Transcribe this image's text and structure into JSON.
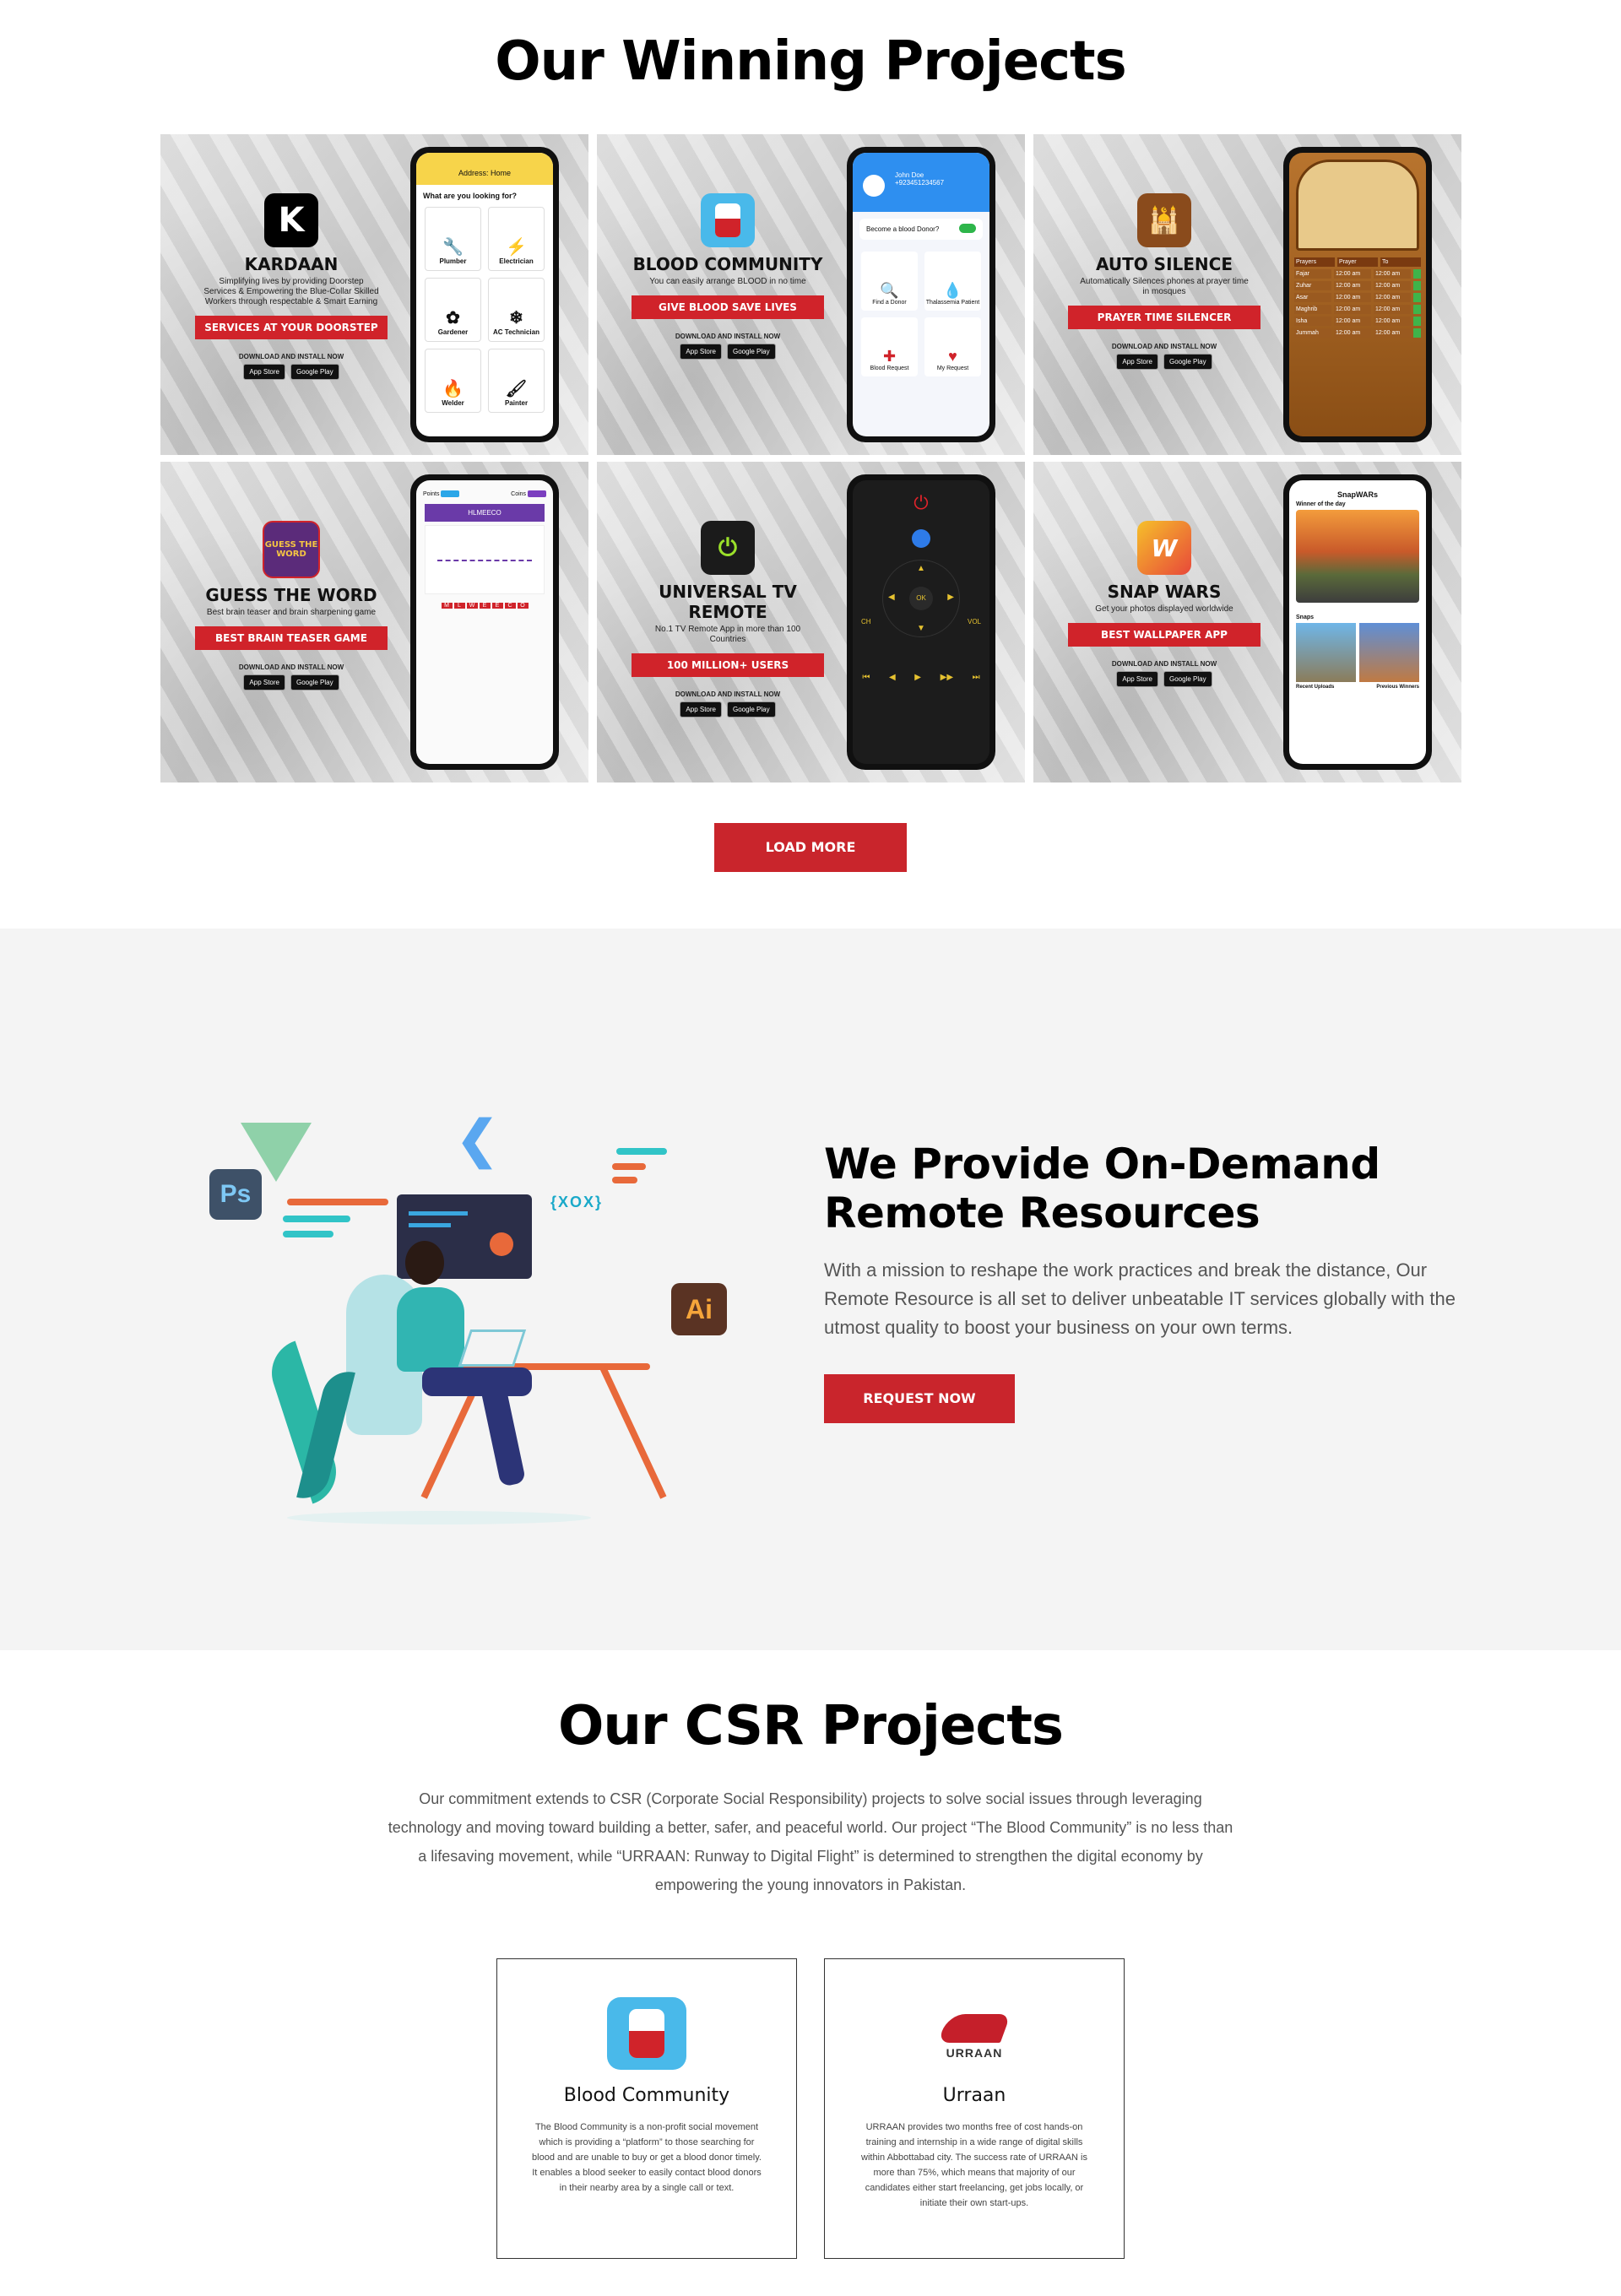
{
  "winning": {
    "title": "Our Winning Projects",
    "load_more": "LOAD MORE",
    "projects": [
      {
        "name": "KARDAAN",
        "sub": "Simplifying lives by providing Doorstep Services & Empowering the Blue-Collar Skilled Workers through respectable & Smart Earning",
        "tag": "SERVICES AT YOUR DOORSTEP",
        "download": "DOWNLOAD AND INSTALL NOW",
        "app_store": "App Store",
        "google_play": "Google Play",
        "screen_header": "Address: Home",
        "screen_question": "What are you looking for?",
        "services": [
          "Plumber",
          "Electrician",
          "Gardener",
          "AC Technician",
          "Welder",
          "Painter"
        ]
      },
      {
        "name": "BLOOD COMMUNITY",
        "sub": "You can easily arrange BLOOD in no time",
        "tag": "GIVE BLOOD SAVE LIVES",
        "download": "DOWNLOAD AND INSTALL NOW",
        "app_store": "App Store",
        "google_play": "Google Play",
        "user_name": "John Doe",
        "user_phone": "+923451234567",
        "donor_toggle": "Become a blood Donor?",
        "options": [
          "Find a Donor",
          "Thalassemia Patient",
          "Blood Request",
          "My Request"
        ]
      },
      {
        "name": "AUTO SILENCE",
        "sub": "Automatically Silences phones at prayer time in mosques",
        "tag": "PRAYER TIME SILENCER",
        "download": "DOWNLOAD AND INSTALL NOW",
        "app_store": "App Store",
        "google_play": "Google Play",
        "table_head": [
          "Prayers",
          "Prayer",
          "To"
        ],
        "prayers": [
          "Fajar",
          "Zuhar",
          "Asar",
          "Maghrib",
          "Isha",
          "Jummah"
        ],
        "time": "12:00 am"
      },
      {
        "name": "GUESS THE WORD",
        "sub": "Best brain teaser and brain sharpening game",
        "tag": "BEST BRAIN TEASER GAME",
        "download": "DOWNLOAD AND INSTALL NOW",
        "app_store": "App Store",
        "google_play": "Google Play",
        "icon_text": "GUESS THE WORD",
        "points_label": "Points",
        "coins_label": "Coins",
        "scrambled": "HLMEECO",
        "letters": [
          "M",
          "L",
          "W",
          "E",
          "E",
          "C",
          "O"
        ]
      },
      {
        "name": "UNIVERSAL TV REMOTE",
        "sub": "No.1 TV Remote App in more than 100 Countries",
        "tag": "100 MILLION+ USERS",
        "download": "DOWNLOAD AND INSTALL NOW",
        "app_store": "App Store",
        "google_play": "Google Play",
        "ok": "OK",
        "ch": "CH",
        "vol": "VOL"
      },
      {
        "name": "SNAP WARS",
        "sub": "Get your photos displayed worldwide",
        "tag": "BEST WALLPAPER APP",
        "download": "DOWNLOAD AND INSTALL NOW",
        "app_store": "App Store",
        "google_play": "Google Play",
        "screen_title": "SnapWARs",
        "winner": "Winner of the day",
        "snaps": "Snaps",
        "recent": "Recent Uploads",
        "previous": "Previous Winners"
      }
    ]
  },
  "remote": {
    "title_line1": "We Provide On-Demand",
    "title_line2": "Remote Resources",
    "body": "With a mission to reshape the work practices and break the distance, Our Remote Resource is all set to deliver unbeatable IT services globally with the utmost quality to boost your business on your own terms.",
    "button": "REQUEST NOW",
    "ps_badge": "Ps",
    "ai_badge": "Ai",
    "code_tag": "{XOX}"
  },
  "csr": {
    "title": "Our CSR Projects",
    "intro": "Our commitment extends to CSR (Corporate Social Responsibility) projects to solve social issues through leveraging technology and moving toward building a better, safer, and peaceful world. Our project “The Blood Community” is no less than a lifesaving movement, while “URRAAN: Runway to Digital Flight” is determined to strengthen the digital economy by empowering the young innovators in Pakistan.",
    "cards": [
      {
        "title": "Blood Community",
        "desc": "The Blood Community is a non-profit social movement which is providing a “platform” to those searching for blood and are unable to buy or get a blood donor timely. It enables a blood seeker to easily contact blood donors in their nearby area by a single call or text."
      },
      {
        "title": "Urraan",
        "logo_text": "URRAAN",
        "desc": "URRAAN provides two months free of cost hands-on training and internship in a wide range of digital skills within Abbottabad city. The success rate of URRAAN is more than 75%, which means that majority of our candidates either start freelancing, get jobs locally, or initiate their own start-ups."
      }
    ]
  },
  "colors": {
    "accent": "#c9252c",
    "grey_band": "#f4f4f4"
  }
}
